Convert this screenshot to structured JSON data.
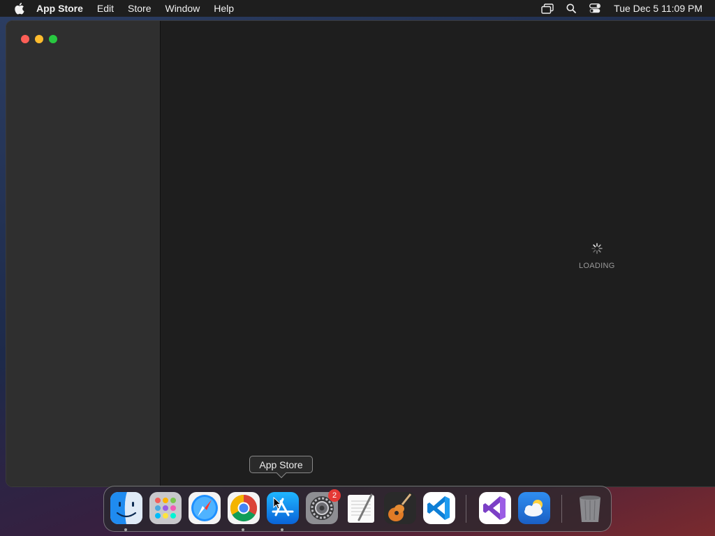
{
  "menubar": {
    "app_name": "App Store",
    "items": [
      "Edit",
      "Store",
      "Window",
      "Help"
    ],
    "clock": "Tue Dec 5  11:09 PM",
    "status_icons": [
      "screen-mirroring-icon",
      "spotlight-search-icon",
      "control-center-icon"
    ]
  },
  "window": {
    "loading_text": "LOADING"
  },
  "tooltip": {
    "text": "App Store"
  },
  "dock": {
    "items": [
      {
        "name": "Finder",
        "running": true
      },
      {
        "name": "Launchpad",
        "running": false
      },
      {
        "name": "Safari",
        "running": false
      },
      {
        "name": "Google Chrome",
        "running": true
      },
      {
        "name": "App Store",
        "running": true
      },
      {
        "name": "System Settings",
        "running": false,
        "badge": "2"
      },
      {
        "name": "TextEdit",
        "running": false
      },
      {
        "name": "GarageBand",
        "running": false
      },
      {
        "name": "Visual Studio Code",
        "running": false
      },
      {
        "name": "Visual Studio",
        "running": false
      },
      {
        "name": "Weather",
        "running": false
      },
      {
        "name": "Trash",
        "running": false
      }
    ]
  },
  "colors": {
    "close": "#fe5f57",
    "minimize": "#febc2e",
    "zoom": "#28c840",
    "badge": "#e53935"
  }
}
